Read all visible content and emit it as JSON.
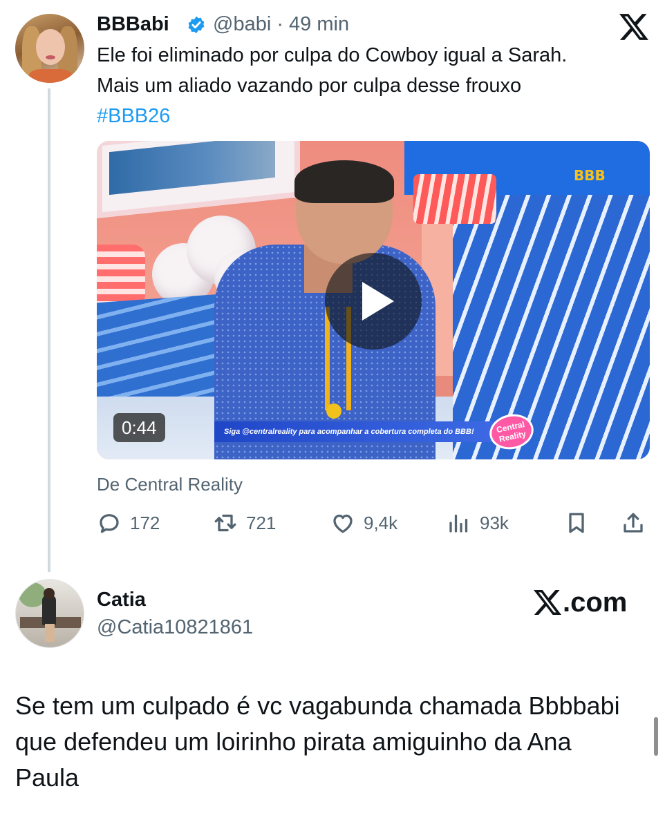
{
  "tweet": {
    "author_name": "BBBabi",
    "handle_time": "@babi · 49 min",
    "text": "Ele foi eliminado por culpa do Cowboy igual a Sarah.\nMais um aliado vazando por culpa desse frouxo",
    "hashtag": "#BBB26",
    "video": {
      "duration": "0:44",
      "banner_text": "Siga @centralreality para acompanhar a cobertura completa do BBB!",
      "logo_text": "Central Reality",
      "corner_logo": "BBB"
    },
    "source": "De Central Reality",
    "actions": {
      "replies": "172",
      "retweets": "721",
      "likes": "9,4k",
      "views": "93k"
    }
  },
  "reply": {
    "author_name": "Catia",
    "handle": "@Catia10821861",
    "brand": ".com",
    "text": "Se tem um culpado é vc vagabunda chamada Bbbbabi que defendeu um loirinho pirata amiguinho da Ana Paula"
  },
  "colors": {
    "accent": "#1d9bf0",
    "secondary_text": "#536471",
    "primary_text": "#0f1419"
  },
  "icons": [
    "verified-badge-icon",
    "x-logo-icon",
    "play-icon",
    "reply-icon",
    "retweet-icon",
    "like-icon",
    "views-icon",
    "bookmark-icon",
    "share-icon"
  ]
}
